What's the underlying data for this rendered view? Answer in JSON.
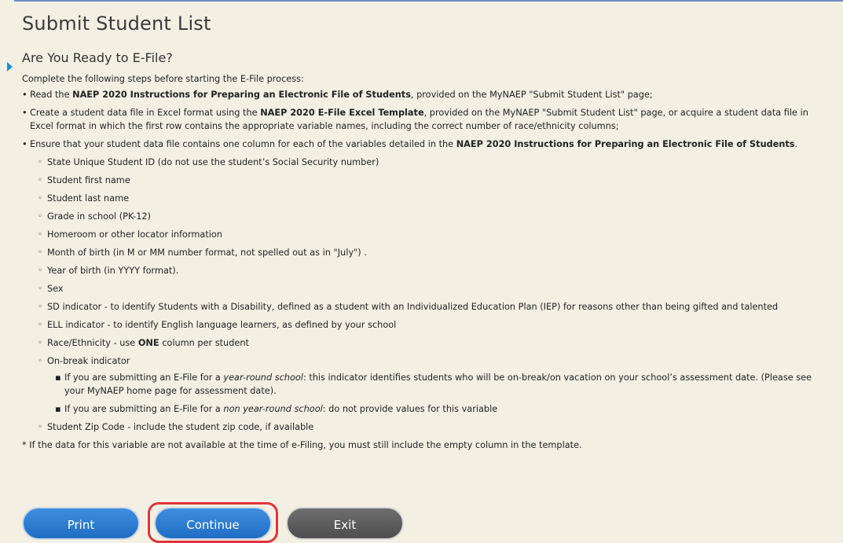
{
  "page": {
    "title": "Submit Student List",
    "subtitle": "Are You Ready to E-File?",
    "intro": "Complete the following steps before starting the E-File process:"
  },
  "steps": [
    {
      "pre": "Read the ",
      "bold": "NAEP 2020 Instructions for Preparing an Electronic File of Students",
      "post": ", provided on the MyNAEP \"Submit Student List\" page;"
    },
    {
      "pre": "Create a student data file in Excel format using the ",
      "bold": "NAEP 2020 E-File Excel Template",
      "post": ", provided on the MyNAEP \"Submit Student List\" page, or acquire a student data file in Excel format in which the first row contains the appropriate variable names, including the correct number of race/ethnicity columns;"
    },
    {
      "pre": "Ensure that your student data file contains one column for each of the variables detailed in the ",
      "bold": "NAEP 2020 Instructions for Preparing an Electronic File of Students",
      "post": "."
    }
  ],
  "variables": {
    "state_id": "State Unique Student ID (do not use the student’s Social Security number)",
    "first_name": "Student first name",
    "last_name": "Student last name",
    "grade": "Grade in school (PK-12)",
    "homeroom": "Homeroom or other locator information",
    "birth_month": "Month of birth (in M or MM number format, not spelled out as in \"July\") .",
    "birth_year": "Year of birth (in YYYY format).",
    "sex": "Sex",
    "sd": "SD indicator - to identify Students with a Disability, defined as a student with an Individualized Education Plan (IEP) for reasons other than being gifted and talented",
    "ell": "ELL indicator - to identify English language learners, as defined by your school",
    "race_pre": "Race/Ethnicity - use ",
    "race_bold": "ONE",
    "race_post": " column per student",
    "onbreak": "On-break indicator",
    "onbreak_sub1_pre": "If you are submitting an E-File for a ",
    "onbreak_sub1_em": "year-round school",
    "onbreak_sub1_post": ": this indicator identifies students who will be on-break/on vacation on your school’s assessment date. (Please see your MyNAEP home page for assessment date).",
    "onbreak_sub2_pre": "If you are submitting an E-File for a ",
    "onbreak_sub2_em": "non year-round school",
    "onbreak_sub2_post": ": do not provide values for this variable",
    "zip": "Student Zip Code - include the student zip code, if available"
  },
  "footnote": "* If the data for this variable are not available at the time of e-Filing, you must still include the empty column in the template.",
  "buttons": {
    "print": "Print",
    "continue": "Continue",
    "exit": "Exit"
  },
  "colors": {
    "background": "#f3f0e3",
    "button_blue": "#2a7bd3",
    "button_gray": "#5a5a5a",
    "focus_ring": "#e0343b"
  }
}
